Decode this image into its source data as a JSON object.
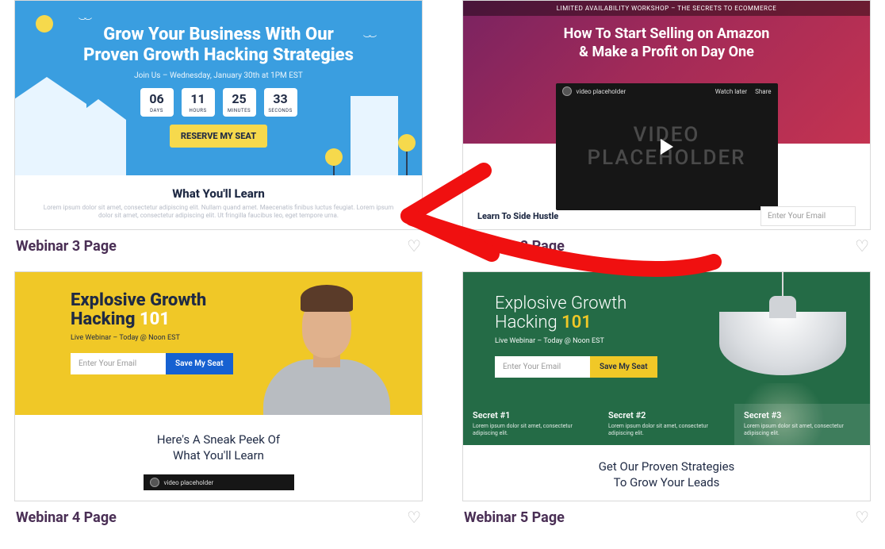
{
  "cards": [
    {
      "title": "Webinar 3 Page",
      "hero": {
        "headline_l1": "Grow Your Business With Our",
        "headline_l2": "Proven Growth Hacking Strategies",
        "subline": "Join Us – Wednesday, January 30th at 1PM EST",
        "countdown": [
          {
            "value": "06",
            "label": "DAYS"
          },
          {
            "value": "11",
            "label": "HOURS"
          },
          {
            "value": "25",
            "label": "MINUTES"
          },
          {
            "value": "33",
            "label": "SECONDS"
          }
        ],
        "cta": "RESERVE MY SEAT"
      },
      "below": {
        "heading": "What You'll Learn",
        "lorem": "Lorem ipsum dolor sit amet, consectetur adipiscing elit. Nullam quand amet. Maecenatis finibus luctus feugiat. Lorem ipsum dolor sit amet, consectetur adipiscing elit. Ut fringilla faucibus leo, eget tempore urna."
      }
    },
    {
      "title": "Webinar 2 Page",
      "hero": {
        "topbar": "LIMITED AVAILABILITY WORKSHOP – THE SECRETS TO ECOMMERCE",
        "headline_l1": "How To Start Selling on Amazon",
        "headline_l2": "& Make a Profit on Day One",
        "video_label": "video placeholder",
        "video_text_l1": "VIDEO",
        "video_text_l2": "PLACEHOLDER",
        "watch_later": "Watch later",
        "share": "Share"
      },
      "below": {
        "side_heading": "Learn To Side Hustle",
        "email_placeholder": "Enter Your Email"
      }
    },
    {
      "title": "Webinar 4 Page",
      "hero": {
        "headline_l1": "Explosive Growth",
        "headline_l2a": "Hacking ",
        "headline_l2b": "101",
        "subline": "Live Webinar – Today @ Noon EST",
        "email_placeholder": "Enter Your Email",
        "cta": "Save My Seat"
      },
      "below": {
        "heading_l1": "Here's A Sneak Peek Of",
        "heading_l2": "What You'll Learn",
        "video_label": "video placeholder"
      }
    },
    {
      "title": "Webinar 5 Page",
      "hero": {
        "headline_l1": "Explosive Growth",
        "headline_l2a": "Hacking ",
        "headline_l2b": "101",
        "subline": "Live Webinar – Today @ Noon EST",
        "email_placeholder": "Enter Your Email",
        "cta": "Save My Seat",
        "secrets": [
          {
            "title": "Secret #1",
            "text": "Lorem ipsum dolor sit amet, consectetur adipiscing elit."
          },
          {
            "title": "Secret #2",
            "text": "Lorem ipsum dolor sit amet, consectetur adipiscing elit."
          },
          {
            "title": "Secret #3",
            "text": "Lorem ipsum dolor sit amet, consectetur adipiscing elit."
          }
        ]
      },
      "below": {
        "heading_l1": "Get Our Proven Strategies",
        "heading_l2": "To Grow Your Leads"
      }
    }
  ]
}
